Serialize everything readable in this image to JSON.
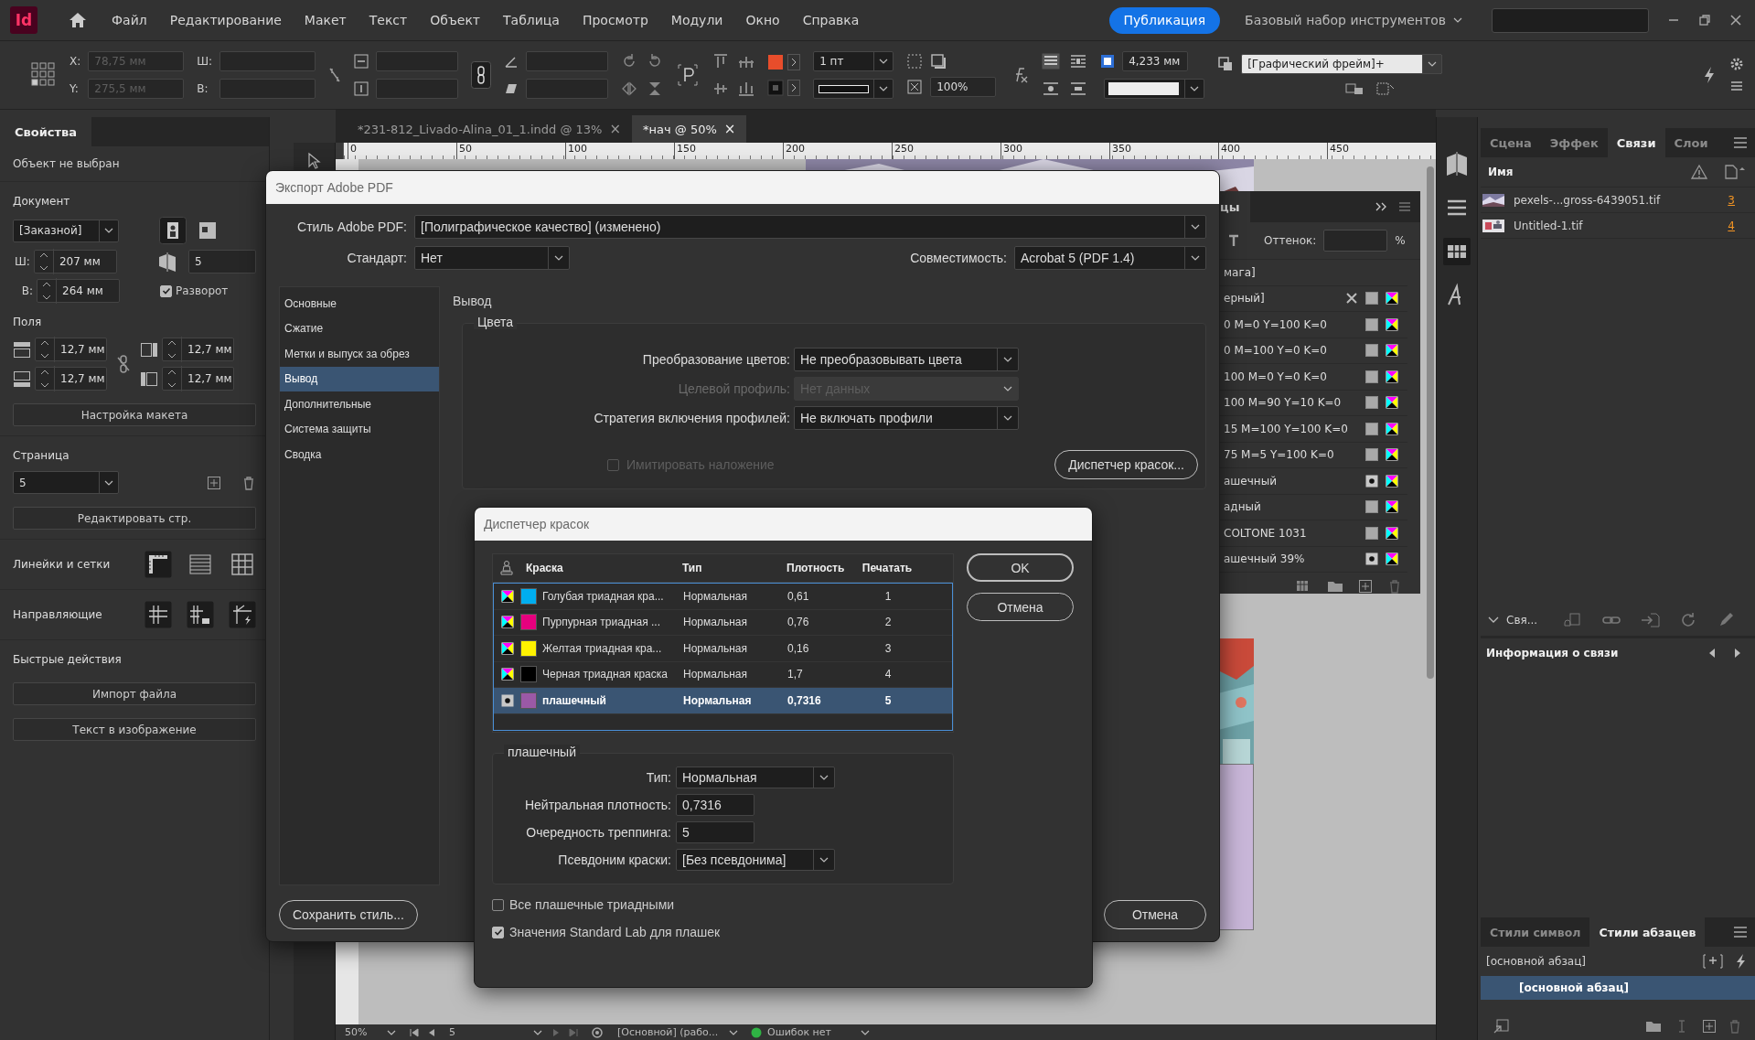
{
  "app": {
    "logo": "Id"
  },
  "menu": [
    "Файл",
    "Редактирование",
    "Макет",
    "Текст",
    "Объект",
    "Таблица",
    "Просмотр",
    "Модули",
    "Окно",
    "Справка"
  ],
  "publish_button": "Публикация",
  "workspace": "Базовый набор инструментов",
  "control_bar": {
    "x_label": "X:",
    "x_value": "78,75 мм",
    "y_label": "Y:",
    "y_value": "275,5 мм",
    "w_label": "Ш:",
    "h_label": "В:",
    "stroke_weight": "1 пт",
    "opacity": "100%",
    "offset": "4,233 мм",
    "object_style": "[Графический фрейм]+"
  },
  "doc_tabs": [
    {
      "label": "*231-812_Livado-Alina_01_1.indd @ 13%",
      "close": "×",
      "selected": false
    },
    {
      "label": "*нач @ 50%",
      "close": "×",
      "selected": true
    }
  ],
  "ruler": [
    "0",
    "50",
    "100",
    "150",
    "200",
    "250",
    "300",
    "350",
    "400",
    "450"
  ],
  "properties_panel": {
    "title": "Свойства",
    "status": "Объект не выбран",
    "document": {
      "label": "Документ",
      "preset": "[Заказной]",
      "w_label": "Ш:",
      "width": "207 мм",
      "h_label": "В:",
      "height": "264 мм",
      "pages": "5",
      "facing": {
        "label": "Разворот",
        "checked": true
      }
    },
    "margins": {
      "label": "Поля",
      "values": [
        "12,7 мм",
        "12,7 мм",
        "12,7 мм",
        "12,7 мм"
      ],
      "layout_button": "Настройка макета"
    },
    "page": {
      "label": "Страница",
      "value": "5",
      "edit_button": "Редактировать стр."
    },
    "rulers_label": "Линейки и сетки",
    "guides_label": "Направляющие",
    "quick_actions": {
      "label": "Быстрые действия",
      "buttons": [
        "Импорт файла",
        "Текст в изображение"
      ]
    }
  },
  "swatches_panel": {
    "tab": "цы",
    "tint_label": "Оттенок:",
    "percent": "%",
    "rows": [
      {
        "name": "мага]",
        "kind": "paper"
      },
      {
        "name": "ерный]",
        "kind": "registration"
      },
      {
        "name": "0 M=0 Y=100 K=0",
        "kind": "process"
      },
      {
        "name": "0 M=100 Y=0 K=0",
        "kind": "process"
      },
      {
        "name": "100 M=0 Y=0 K=0",
        "kind": "process"
      },
      {
        "name": "100 M=90 Y=10 K=0",
        "kind": "process"
      },
      {
        "name": "15 M=100 Y=100 K=0",
        "kind": "process"
      },
      {
        "name": "75 M=5 Y=100 K=0",
        "kind": "process"
      },
      {
        "name": "ашечный",
        "kind": "spot"
      },
      {
        "name": "адный",
        "kind": "process"
      },
      {
        "name": "COLTONE 1031",
        "kind": "process"
      },
      {
        "name": "ашечный 39%",
        "kind": "spot"
      }
    ]
  },
  "links_panel": {
    "tabs": [
      {
        "label": "Сцена",
        "selected": false
      },
      {
        "label": "Эффек",
        "selected": false
      },
      {
        "label": "Связи",
        "selected": true
      },
      {
        "label": "Слои",
        "selected": false
      }
    ],
    "column": "Имя",
    "rows": [
      {
        "name": "pexels-...gross-6439051.tif",
        "page": "3"
      },
      {
        "name": "Untitled-1.tif",
        "page": "4"
      }
    ],
    "footer": "Свя...",
    "info": "Информация о связи"
  },
  "styles_panel": {
    "tabs": [
      {
        "label": "Стили символ",
        "selected": false
      },
      {
        "label": "Стили абзацев",
        "selected": true
      }
    ],
    "current": "[основной абзац]",
    "items": [
      {
        "label": "[основной абзац]",
        "selected": true
      }
    ]
  },
  "status_bar": {
    "zoom": "50%",
    "page": "5",
    "style": "[Основной] (рабо...",
    "preflight": "Ошибок нет"
  },
  "export_dialog": {
    "title": "Экспорт Adobe PDF",
    "style_label": "Стиль Adobe PDF:",
    "style": "[Полиграфическое качество] (изменено)",
    "standard_label": "Стандарт:",
    "standard": "Нет",
    "compat_label": "Совместимость:",
    "compat": "Acrobat 5 (PDF 1.4)",
    "nav": [
      {
        "label": "Основные",
        "selected": false
      },
      {
        "label": "Сжатие",
        "selected": false
      },
      {
        "label": "Метки и выпуск за обрез",
        "selected": false
      },
      {
        "label": "Вывод",
        "selected": true
      },
      {
        "label": "Дополнительные",
        "selected": false
      },
      {
        "label": "Система защиты",
        "selected": false
      },
      {
        "label": "Сводка",
        "selected": false
      }
    ],
    "section": "Вывод",
    "group": "Цвета",
    "rows": [
      {
        "label": "Преобразование цветов:",
        "value": "Не преобразовывать цвета",
        "disabled": false
      },
      {
        "label": "Целевой профиль:",
        "value": "Нет данных",
        "disabled": true
      },
      {
        "label": "Стратегия включения профилей:",
        "value": "Не включать профили",
        "disabled": false
      }
    ],
    "simulate": {
      "label": "Имитировать наложение",
      "checked": false,
      "disabled": true
    },
    "ink_button": "Диспетчер красок...",
    "save_button": "Сохранить стиль...",
    "cancel_button": "Отмена"
  },
  "ink_manager": {
    "title": "Диспетчер красок",
    "columns": [
      "Краска",
      "Тип",
      "Плотность",
      "Печатать"
    ],
    "inks": [
      {
        "kind": "process",
        "color": "#00aeef",
        "name": "Голубая триадная кра...",
        "type": "Нормальная",
        "density": "0,61",
        "sequence": "1",
        "selected": false
      },
      {
        "kind": "process",
        "color": "#e6007e",
        "name": "Пурпурная триадная ...",
        "type": "Нормальная",
        "density": "0,76",
        "sequence": "2",
        "selected": false
      },
      {
        "kind": "process",
        "color": "#fff200",
        "name": "Желтая триадная кра...",
        "type": "Нормальная",
        "density": "0,16",
        "sequence": "3",
        "selected": false
      },
      {
        "kind": "process",
        "color": "#000000",
        "name": "Черная триадная краска",
        "type": "Нормальная",
        "density": "1,7",
        "sequence": "4",
        "selected": false
      },
      {
        "kind": "spot",
        "color": "#9b59a6",
        "name": "плашечный",
        "type": "Нормальная",
        "density": "0,7316",
        "sequence": "5",
        "selected": true
      }
    ],
    "ok_button": "OK",
    "cancel_button": "Отмена",
    "detail": {
      "title": "плашечный",
      "fields": [
        {
          "kind": "select",
          "label": "Тип:",
          "value": "Нормальная"
        },
        {
          "kind": "input",
          "label": "Нейтральная плотность:",
          "value": "0,7316"
        },
        {
          "kind": "input",
          "label": "Очередность треппинга:",
          "value": "5"
        },
        {
          "kind": "select",
          "label": "Псевдоним краски:",
          "value": "[Без псевдонима]"
        }
      ]
    },
    "options": [
      {
        "label": "Все плашечные триадными",
        "checked": false
      },
      {
        "label": "Значения Standard Lab для плашек",
        "checked": true
      }
    ]
  }
}
